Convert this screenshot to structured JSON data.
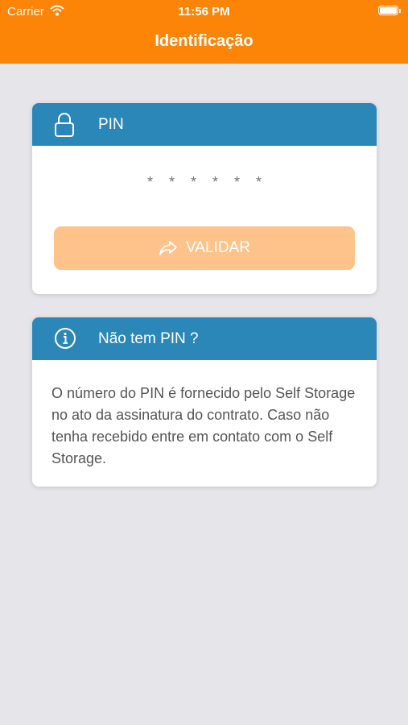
{
  "status_bar": {
    "carrier": "Carrier",
    "time": "11:56 PM",
    "icons": [
      "wifi-icon",
      "battery-icon"
    ]
  },
  "navbar": {
    "title": "Identificação",
    "background": "#fc8508"
  },
  "pin_card": {
    "title": "PIN",
    "icon": "lock-icon",
    "pin_placeholder": "******",
    "validate_label": "VALIDAR",
    "validate_icon": "share-arrow-icon",
    "header_color": "#2c87b9"
  },
  "info_card": {
    "title": "Não tem PIN ?",
    "icon": "info-icon",
    "text": "O número do PIN é fornecido pelo Self Storage no ato da assinatura do contrato. Caso não tenha recebido entre em contato com o Self Storage."
  }
}
